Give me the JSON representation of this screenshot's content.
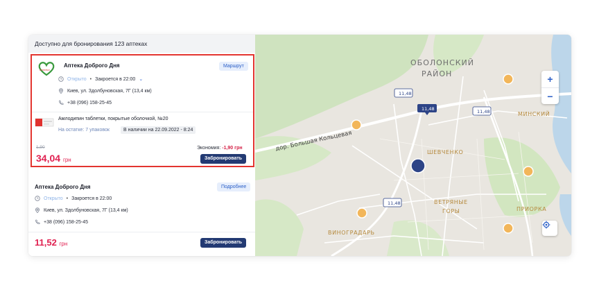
{
  "list": {
    "header": "Доступно для бронирования 123 аптеках",
    "cards": [
      {
        "name": "Аптека Доброго Дня",
        "route_label": "Маршрут",
        "status": "Открыто",
        "closes": "Закроется в 22:00",
        "address": "Киев, ул. Здолбуновская, 7Г (13,4 км)",
        "phone": "+38 (096) 158-25-45",
        "product": "Амлодипин таблетки, покрытые оболочкой, №20",
        "stock": "На остатке: 7 упаковок",
        "availability": "В наличии на 22.09.2022 - 8:24",
        "old_price": "1,90",
        "economy_label": "Экономия:",
        "economy_value": "-1,90 грн",
        "price": "34,04",
        "currency": "грн",
        "reserve_label": "Забронировать"
      },
      {
        "name": "Аптека Доброго Дня",
        "details_label": "Подробнее",
        "status": "Открыто",
        "closes": "Закроется в 22:00",
        "address": "Киев, ул. Здолбуновская, 7Г (13,4 км)",
        "phone": "+38 (096) 158-25-45",
        "price": "11,52",
        "currency": "грн",
        "reserve_label": "Забронировать"
      }
    ]
  },
  "map": {
    "districts": [
      "ОБОЛОНСКИЙ",
      "РАЙОН",
      "МИНСКИЙ",
      "ШЕВЧЕНКО",
      "ВЕТРЯНЫЕ",
      "ГОРЫ",
      "ПРИОРКА",
      "ВИНОГРАДАРЬ"
    ],
    "road": "дор. Большая Кольцевая",
    "price_tags": [
      "11,48",
      "11,48",
      "11,48",
      "11,48"
    ],
    "zoom_in": "+",
    "zoom_out": "−",
    "icons": {
      "locate": "locate-icon",
      "clock": "clock-icon",
      "pin": "pin-icon",
      "phone": "phone-icon"
    },
    "colors": {
      "pharmacy_marker": "#f2b65a",
      "selected_marker": "#2d4487",
      "accent": "#e02050",
      "primary_button": "#233a73"
    }
  }
}
